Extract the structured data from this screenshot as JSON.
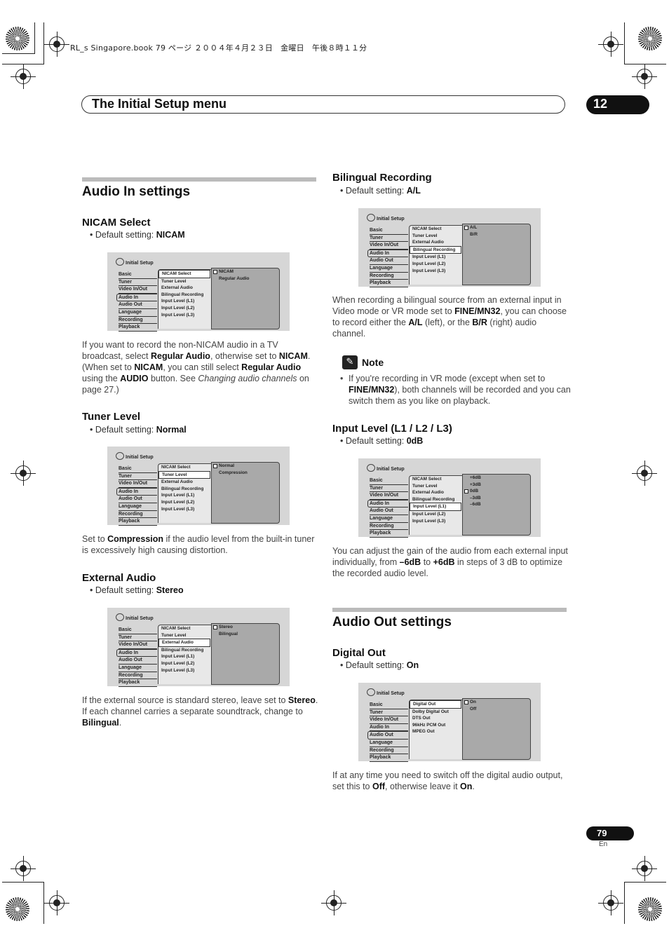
{
  "slug": "RL_s Singapore.book 79 ページ ２００４年４月２３日　金曜日　午後８時１１分",
  "header": {
    "title": "The Initial Setup menu",
    "chapter": "12"
  },
  "page": {
    "number": "79",
    "lang": "En"
  },
  "screen_common": {
    "title": "Initial Setup",
    "left_menu": [
      "Basic",
      "Tuner",
      "Video In/Out",
      "Audio In",
      "Audio Out",
      "Language",
      "Recording",
      "Playback"
    ],
    "audio_in_items": [
      "NICAM Select",
      "Tuner Level",
      "External Audio",
      "Bilingual Recording",
      "Input Level (L1)",
      "Input Level (L2)",
      "Input Level (L3)"
    ],
    "audio_out_items": [
      "Digital Out",
      "Dolby Digital Out",
      "DTS Out",
      "96kHz PCM Out",
      "MPEG Out"
    ]
  },
  "audio_in": {
    "heading": "Audio In settings",
    "nicam": {
      "heading": "NICAM Select",
      "default_label": "Default setting: ",
      "default_value": "NICAM",
      "options": [
        "NICAM",
        "Regular Audio"
      ],
      "para": [
        {
          "t": "If you want to record the non-NICAM audio in a TV broadcast, select "
        },
        {
          "b": "Regular Audio"
        },
        {
          "t": ", otherwise set to "
        },
        {
          "b": "NICAM"
        },
        {
          "t": ". (When set to "
        },
        {
          "b": "NICAM"
        },
        {
          "t": ", you can still select "
        },
        {
          "b": "Regular Audio"
        },
        {
          "t": " using the "
        },
        {
          "b": "AUDIO"
        },
        {
          "t": " button. See "
        },
        {
          "i": "Changing audio channels"
        },
        {
          "t": " on page 27.)"
        }
      ]
    },
    "tuner": {
      "heading": "Tuner Level",
      "default_label": "Default setting: ",
      "default_value": "Normal",
      "options": [
        "Normal",
        "Compression"
      ],
      "para": [
        {
          "t": "Set to "
        },
        {
          "b": "Compression"
        },
        {
          "t": " if the audio level from the built-in tuner is excessively high causing distortion."
        }
      ]
    },
    "external": {
      "heading": "External Audio",
      "default_label": "Default setting: ",
      "default_value": "Stereo",
      "options": [
        "Stereo",
        "Bilingual"
      ],
      "para": [
        {
          "t": "If the external source is standard stereo, leave set to "
        },
        {
          "b": "Stereo"
        },
        {
          "t": ". If each channel carries a separate soundtrack, change to "
        },
        {
          "b": "Bilingual"
        },
        {
          "t": "."
        }
      ]
    },
    "bilingual": {
      "heading": "Bilingual Recording",
      "default_label": "Default setting: ",
      "default_value": "A/L",
      "options": [
        "A/L",
        "B/R"
      ],
      "para": [
        {
          "t": "When recording a bilingual source from an external input in Video mode or VR mode set to "
        },
        {
          "b": "FINE/MN32"
        },
        {
          "t": ", you can choose to record either the "
        },
        {
          "b": "A/L"
        },
        {
          "t": " (left), or the "
        },
        {
          "b": "B/R"
        },
        {
          "t": " (right) audio channel."
        }
      ]
    },
    "note": {
      "label": "Note",
      "para": [
        {
          "t": "If you're recording in VR mode (except when set to "
        },
        {
          "b": "FINE/MN32"
        },
        {
          "t": "), both channels will be recorded and you can switch them as you like on playback."
        }
      ]
    },
    "input_level": {
      "heading": "Input Level (L1 / L2 / L3)",
      "default_label": "Default setting: ",
      "default_value": "0dB",
      "options": [
        "+6dB",
        "+3dB",
        "0dB",
        "–3dB",
        "–6dB"
      ],
      "para": [
        {
          "t": "You can adjust the gain of the audio from each external input individually, from "
        },
        {
          "b": "–6dB"
        },
        {
          "t": " to "
        },
        {
          "b": "+6dB"
        },
        {
          "t": " in steps of 3 dB to optimize the recorded audio level."
        }
      ]
    }
  },
  "audio_out": {
    "heading": "Audio Out settings",
    "digital": {
      "heading": "Digital Out",
      "default_label": "Default setting: ",
      "default_value": "On",
      "options": [
        "On",
        "Off"
      ],
      "para": [
        {
          "t": "If at any time you need to switch off the digital audio output, set this to "
        },
        {
          "b": "Off"
        },
        {
          "t": ", otherwise leave it "
        },
        {
          "b": "On"
        },
        {
          "t": "."
        }
      ]
    }
  }
}
